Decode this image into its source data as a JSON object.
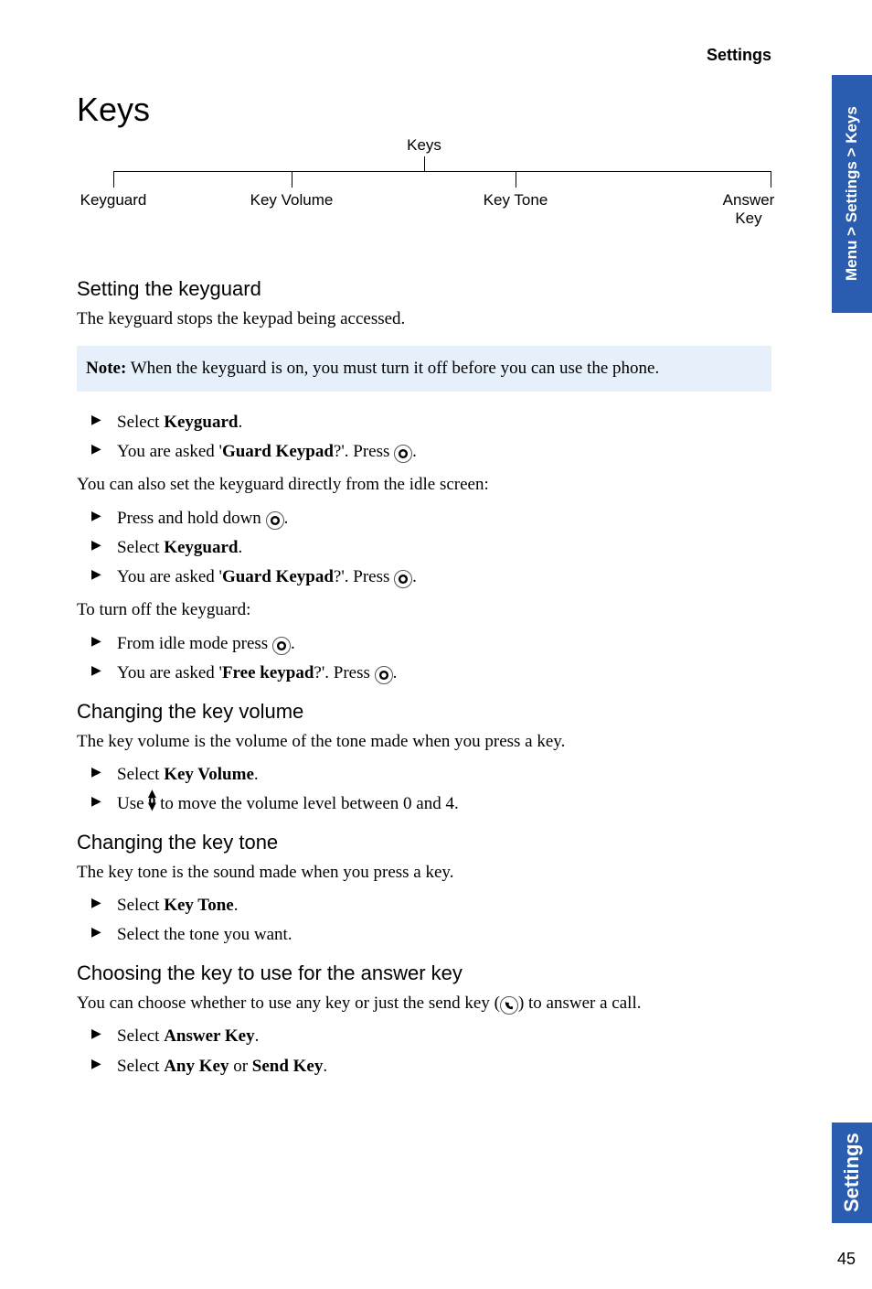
{
  "header": {
    "section": "Settings"
  },
  "h1": "Keys",
  "tree": {
    "root": "Keys",
    "branches": [
      "Keyguard",
      "Key Volume",
      "Key Tone",
      "Answer Key"
    ]
  },
  "sec1": {
    "title": "Setting the keyguard",
    "intro": "The keyguard stops the keypad being accessed.",
    "note_label": "Note:",
    "note_text": " When the keyguard is on, you must turn it off before you can use the phone.",
    "b1_a": "Select ",
    "b1_b": "Keyguard",
    "b1_c": ".",
    "b2_a": "You are asked '",
    "b2_b": "Guard Keypad",
    "b2_c": "?'. Press ",
    "b2_d": ".",
    "mid1": "You can also set the keyguard directly from the idle screen:",
    "b3_a": "Press and hold down ",
    "b3_b": ".",
    "b4_a": "Select ",
    "b4_b": "Keyguard",
    "b4_c": ".",
    "b5_a": "You are asked '",
    "b5_b": "Guard Keypad",
    "b5_c": "?'. Press ",
    "b5_d": ".",
    "mid2": "To turn off the keyguard:",
    "b6_a": "From idle mode press ",
    "b6_b": ".",
    "b7_a": "You are asked '",
    "b7_b": "Free keypad",
    "b7_c": "?'. Press ",
    "b7_d": "."
  },
  "sec2": {
    "title": "Changing the key volume",
    "intro": "The key volume is the volume of the tone made when you press a key.",
    "b1_a": "Select ",
    "b1_b": "Key Volume",
    "b1_c": ".",
    "b2_a": "Use ",
    "b2_b": " to move the volume level between 0 and 4."
  },
  "sec3": {
    "title": "Changing the key tone",
    "intro": "The key tone is the sound made when you press a key.",
    "b1_a": "Select ",
    "b1_b": "Key Tone",
    "b1_c": ".",
    "b2": "Select the tone you want."
  },
  "sec4": {
    "title": "Choosing the key to use for the answer key",
    "intro_a": "You can choose whether to use any key or just the send key (",
    "intro_b": ") to answer a call.",
    "b1_a": "Select ",
    "b1_b": "Answer Key",
    "b1_c": ".",
    "b2_a": "Select ",
    "b2_b": "Any Key",
    "b2_c": " or ",
    "b2_d": "Send Key",
    "b2_e": "."
  },
  "sidebar": {
    "breadcrumb": "Menu > Settings > Keys",
    "section": "Settings"
  },
  "page_number": "45"
}
